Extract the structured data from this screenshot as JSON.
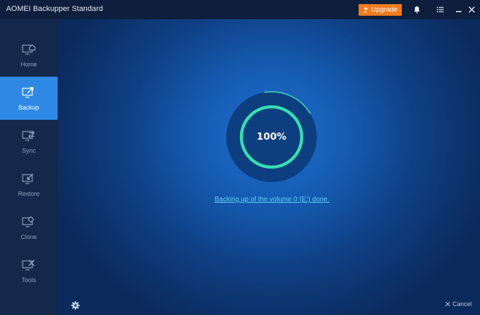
{
  "app": {
    "title": "AOMEI Backupper Standard"
  },
  "titlebar": {
    "upgrade_label": "Upgrade",
    "upgrade_color": "#f27b1e"
  },
  "sidebar": {
    "items": [
      {
        "label": "Home",
        "icon": "home-icon",
        "active": false
      },
      {
        "label": "Backup",
        "icon": "backup-icon",
        "active": true
      },
      {
        "label": "Sync",
        "icon": "sync-icon",
        "active": false
      },
      {
        "label": "Restore",
        "icon": "restore-icon",
        "active": false
      },
      {
        "label": "Clone",
        "icon": "clone-icon",
        "active": false
      },
      {
        "label": "Tools",
        "icon": "tools-icon",
        "active": false
      }
    ],
    "active_color": "#2f88e4"
  },
  "main": {
    "progress_text": "100%",
    "progress_value": 1.0,
    "status_text": "Backing up of the volume 0 (E:) done.",
    "ring_color": "#35e0b0",
    "link_color": "#5fd3f3"
  },
  "footer": {
    "cancel_label": "Cancel"
  }
}
